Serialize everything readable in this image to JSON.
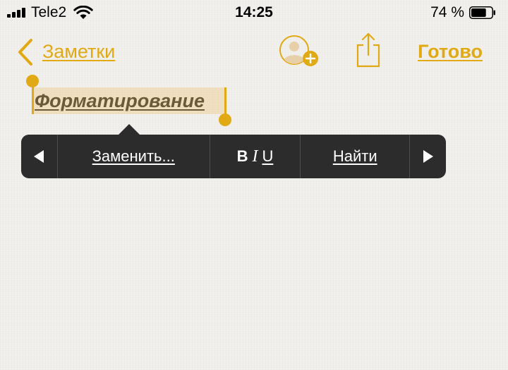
{
  "status_bar": {
    "carrier": "Tele2",
    "time": "14:25",
    "battery_percent": "74 %",
    "battery_level": 0.74,
    "signal_bars": 4
  },
  "nav": {
    "back_label": "Заметки",
    "done_label": "Готово",
    "accent_color": "#e1a914"
  },
  "note": {
    "selected_text": "Форматирование",
    "text_style": [
      "bold",
      "italic",
      "underline"
    ]
  },
  "edit_menu": {
    "prev_icon": "triangle-left-icon",
    "replace_label": "Заменить...",
    "bold_label": "B",
    "italic_label": "I",
    "underline_label": "U",
    "find_label": "Найти",
    "next_icon": "triangle-right-icon"
  },
  "icons": {
    "back": "chevron-left-icon",
    "add_person": "add-person-icon",
    "share": "share-icon",
    "wifi": "wifi-icon",
    "battery": "battery-icon"
  }
}
